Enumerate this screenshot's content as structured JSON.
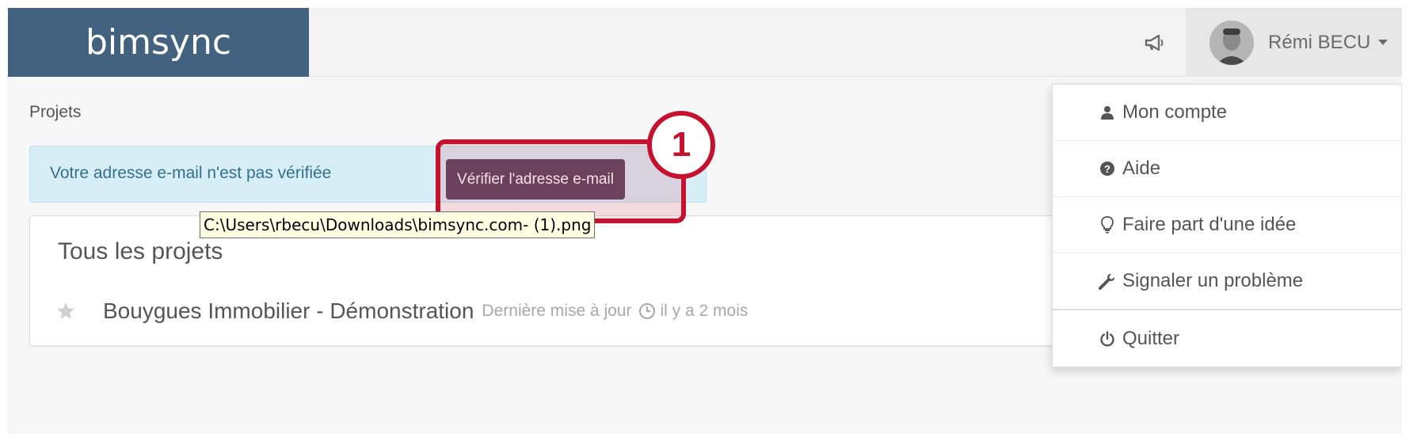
{
  "header": {
    "brand": "bimsync",
    "user_name": "Rémi BECU"
  },
  "breadcrumb": "Projets",
  "alert": {
    "text": "Votre adresse e-mail n'est pas vérifiée",
    "button_label": "Vérifier l'adresse e-mail"
  },
  "annotation": {
    "badge": "1",
    "tooltip": "C:\\Users\\rbecu\\Downloads\\bimsync.com- (1).png"
  },
  "projects": {
    "title": "Tous les projets",
    "items": [
      {
        "name": "Bouygues Immobilier - Démonstration",
        "updated_label": "Dernière mise à jour",
        "updated_when": "il y a 2 mois"
      }
    ]
  },
  "user_menu": {
    "items": [
      {
        "label": "Mon compte",
        "icon": "user-icon"
      },
      {
        "label": "Aide",
        "icon": "question-circle-icon"
      },
      {
        "label": "Faire part d'une idée",
        "icon": "lightbulb-icon"
      },
      {
        "label": "Signaler un problème",
        "icon": "wrench-icon"
      },
      {
        "label": "Quitter",
        "icon": "power-icon"
      }
    ]
  },
  "colors": {
    "brand_bg": "#43627f",
    "alert_bg": "#d8eef7",
    "alert_text": "#31708f",
    "verify_button": "#5a4560",
    "annotation_red": "#c4122f"
  }
}
